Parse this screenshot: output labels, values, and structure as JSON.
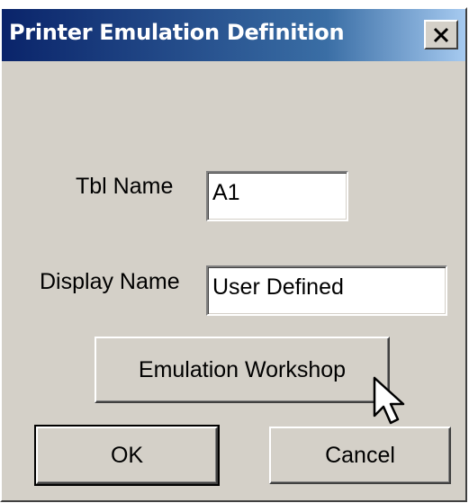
{
  "window": {
    "title": "Printer Emulation Definition",
    "close_glyph": "✕"
  },
  "form": {
    "tbl_name": {
      "label": "Tbl Name",
      "value": "A1"
    },
    "display_name": {
      "label": "Display Name",
      "value": "User Defined"
    }
  },
  "buttons": {
    "workshop_label": "Emulation Workshop",
    "ok_label": "OK",
    "cancel_label": "Cancel"
  },
  "icons": {
    "close": "close-icon",
    "cursor": "mouse-pointer-icon"
  },
  "colors": {
    "titlebar_start": "#0a246a",
    "titlebar_end": "#a6caf0",
    "dialog_bg": "#d4d0c8"
  }
}
